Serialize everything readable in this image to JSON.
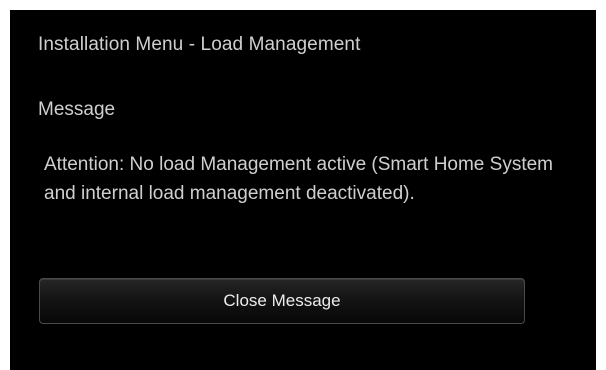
{
  "menu": {
    "title": "Installation Menu - Load Management"
  },
  "message": {
    "heading": "Message",
    "body": "Attention: No load Management active (Smart Home System and internal load management deactivated).",
    "close_label": "Close Message"
  },
  "colors": {
    "background": "#000000",
    "text": "#cfcfcf",
    "button_border": "#4a4a4a"
  }
}
